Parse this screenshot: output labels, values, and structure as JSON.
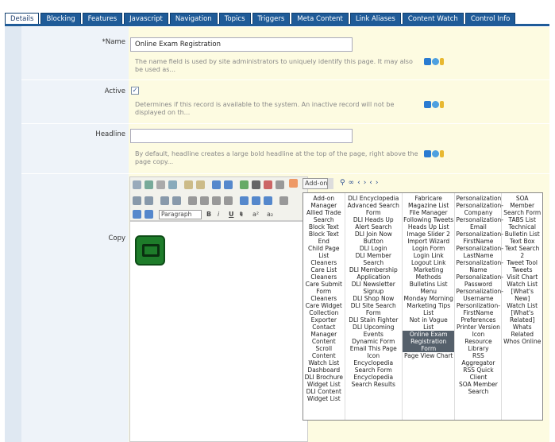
{
  "tabs": [
    "Details",
    "Blocking",
    "Features",
    "Javascript",
    "Navigation",
    "Topics",
    "Triggers",
    "Meta Content",
    "Link Aliases",
    "Content Watch",
    "Control Info"
  ],
  "form": {
    "name_label": "*Name",
    "name_value": "Online Exam Registration",
    "name_help": "The name field is used by site administrators to uniquely identify this page. It may also be used as...",
    "active_label": "Active",
    "active_checked": "✓",
    "active_help": "Determines if this record is available to the system. An inactive record will not be displayed on th...",
    "headline_label": "Headline",
    "headline_value": "",
    "headline_help": "By default, headline creates a large bold headline at the top of the page, right above the page copy...",
    "copy_label": "Copy"
  },
  "editor": {
    "addons_label": "Add-ons",
    "format_label": "Paragraph",
    "bold": "B",
    "italic": "i",
    "underline": "U",
    "strike": "ŧ",
    "sup": "a²",
    "sub": "a₂"
  },
  "addons_menu": [
    [
      {
        "t": "Add-on Manager"
      },
      {
        "t": "Allied Trade Search"
      },
      {
        "t": "Block Text"
      },
      {
        "t": "Block Text End"
      },
      {
        "t": "Child Page List"
      },
      {
        "t": "Cleaners"
      },
      {
        "t": "Care List"
      },
      {
        "t": "Cleaners"
      },
      {
        "t": "Care Submit Form"
      },
      {
        "t": "Cleaners"
      },
      {
        "t": "Care Widget"
      },
      {
        "t": "Collection Exporter"
      },
      {
        "t": "Contact Manager"
      },
      {
        "t": "Content Scroll"
      },
      {
        "t": "Content Watch List"
      },
      {
        "t": "Dashboard"
      },
      {
        "t": "DLI Brochure Widget List"
      },
      {
        "t": "DLI Content Widget List"
      }
    ],
    [
      {
        "t": "DLI Encyclopedia Advanced Search Form"
      },
      {
        "t": "DLI Heads Up Alert Search"
      },
      {
        "t": "DLI Join Now Button"
      },
      {
        "t": "DLI Login"
      },
      {
        "t": "DLI Member Search"
      },
      {
        "t": "DLI Membership Application"
      },
      {
        "t": "DLI Newsletter Signup"
      },
      {
        "t": "DLI Shop Now"
      },
      {
        "t": "DLI Site Search Form"
      },
      {
        "t": "DLI Stain Fighter"
      },
      {
        "t": "DLI Upcoming Events"
      },
      {
        "t": "Dynamic Form"
      },
      {
        "t": "Email This Page Icon"
      },
      {
        "t": "Encyclopedia Search Form"
      },
      {
        "t": "Encyclopedia Search Results"
      }
    ],
    [
      {
        "t": "Fabricare Magazine List"
      },
      {
        "t": "File Manager"
      },
      {
        "t": "Following Tweets"
      },
      {
        "t": "Heads Up List"
      },
      {
        "t": "Image Slider 2"
      },
      {
        "t": "Import Wizard"
      },
      {
        "t": "Login Form"
      },
      {
        "t": "Login Link"
      },
      {
        "t": "Logout Link"
      },
      {
        "t": "Marketing Methods Bulletins List"
      },
      {
        "t": "Menu"
      },
      {
        "t": "Monday Morning Marketing Tips List"
      },
      {
        "t": "Not in Vogue List"
      },
      {
        "t": "Online Exam Registration Form",
        "sel": true
      },
      {
        "t": "Page View Chart"
      }
    ],
    [
      {
        "t": "Personalization Personalization-Company"
      },
      {
        "t": "Personalization-Email"
      },
      {
        "t": "Personalization-FirstName"
      },
      {
        "t": "Personalization-LastName"
      },
      {
        "t": "Personalization-Name"
      },
      {
        "t": "Personalization-Password"
      },
      {
        "t": "Personalization-Username"
      },
      {
        "t": "Personlization-FirstName"
      },
      {
        "t": "Preferences"
      },
      {
        "t": "Printer Version Icon"
      },
      {
        "t": "Resource Library"
      },
      {
        "t": "RSS Aggregator"
      },
      {
        "t": "RSS Quick Client"
      },
      {
        "t": "SOA Member Search"
      }
    ],
    [
      {
        "t": "SOA Member Search Form"
      },
      {
        "t": "TABS List"
      },
      {
        "t": "Technical Bulletin List"
      },
      {
        "t": "Text Box"
      },
      {
        "t": "Text Search 2"
      },
      {
        "t": "Tweet Tool"
      },
      {
        "t": "Tweets"
      },
      {
        "t": "Visit Chart"
      },
      {
        "t": "Watch List [What's New]"
      },
      {
        "t": "Watch List [What's Related]"
      },
      {
        "t": "Whats Related"
      },
      {
        "t": "Whos Online"
      }
    ]
  ],
  "colors": {
    "tab_bg": "#1f5b98",
    "content_bg": "#fdfbe1",
    "label_bg": "#eef3f9",
    "menu_sel": "#55606b"
  }
}
